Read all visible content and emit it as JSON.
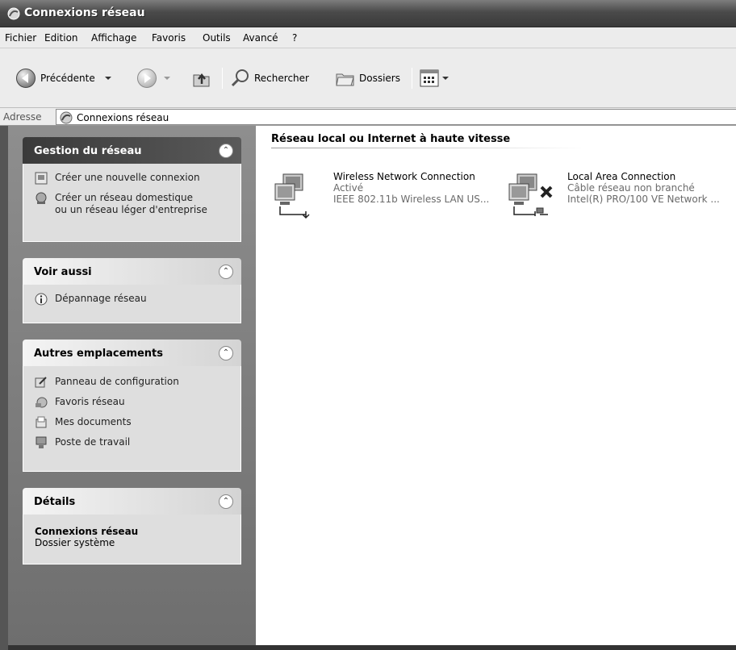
{
  "window": {
    "title": "Connexions réseau"
  },
  "menu": [
    "Fichier",
    "Edition",
    "Affichage",
    "Favoris",
    "Outils",
    "Avancé",
    "?"
  ],
  "toolbar": {
    "back_label": "Précédente",
    "search_label": "Rechercher",
    "folders_label": "Dossiers"
  },
  "address": {
    "label": "Adresse",
    "value": "Connexions réseau"
  },
  "tasks": {
    "network": {
      "title": "Gestion du réseau",
      "items": [
        {
          "label": "Créer une nouvelle connexion",
          "icon": "new-connection-icon"
        },
        {
          "label_line1": "Créer un réseau domestique",
          "label_line2": "ou un réseau léger d'entreprise",
          "icon": "home-network-icon"
        }
      ]
    },
    "see_also": {
      "title": "Voir aussi",
      "items": [
        {
          "label": "Dépannage réseau",
          "icon": "info-icon"
        }
      ]
    },
    "other_places": {
      "title": "Autres emplacements",
      "items": [
        {
          "label": "Panneau de configuration",
          "icon": "control-panel-icon"
        },
        {
          "label": "Favoris réseau",
          "icon": "network-places-icon"
        },
        {
          "label": "Mes documents",
          "icon": "documents-icon"
        },
        {
          "label": "Poste de travail",
          "icon": "computer-icon"
        }
      ]
    },
    "details": {
      "title": "Détails",
      "name": "Connexions réseau",
      "type": "Dossier système"
    }
  },
  "content": {
    "group_title": "Réseau local ou Internet à haute vitesse",
    "connections": [
      {
        "name": "Wireless Network Connection",
        "status": "Activé",
        "device": "IEEE 802.11b Wireless LAN US..."
      },
      {
        "name": "Local Area Connection",
        "status": "Câble réseau non branché",
        "device": "Intel(R) PRO/100 VE Network ..."
      }
    ]
  }
}
